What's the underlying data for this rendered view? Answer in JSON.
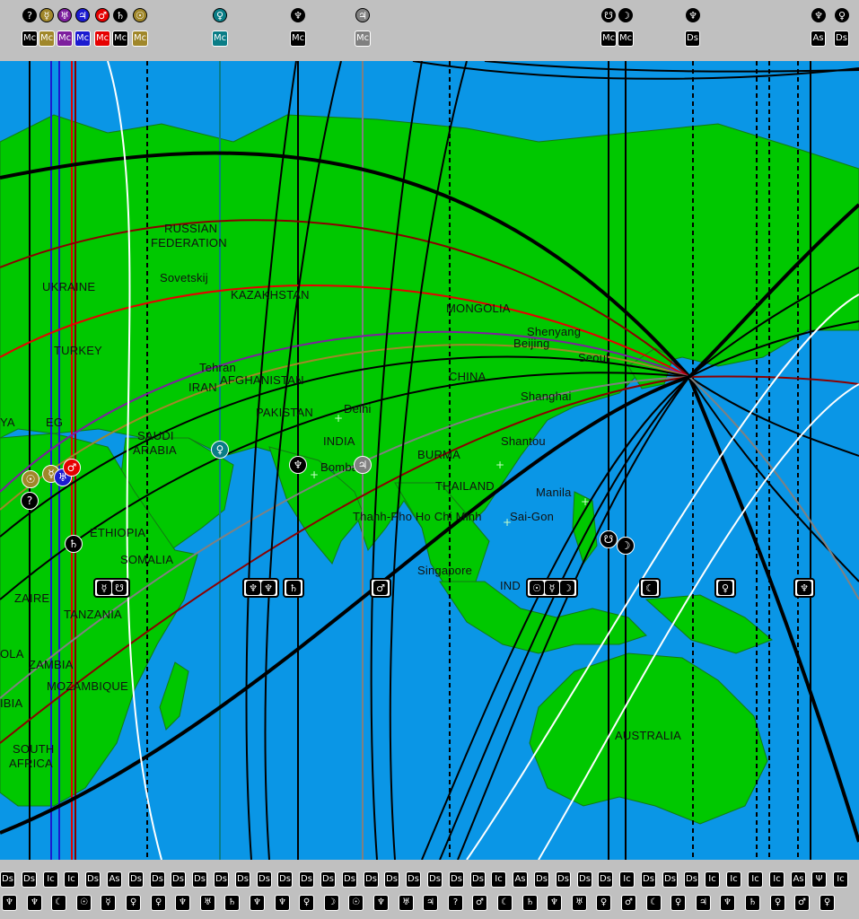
{
  "colors": {
    "ocean": "#0a96e6",
    "land": "#00c800",
    "border": "#137a13",
    "panel": "#c0c0c0"
  },
  "top_markers": [
    {
      "planet": "?",
      "angle": "Mc",
      "bg": "#000000"
    },
    {
      "planet": "☿",
      "angle": "Mc",
      "bg": "#a0872a"
    },
    {
      "planet": "♅",
      "angle": "Mc",
      "bg": "#7d1f9e"
    },
    {
      "planet": "♃",
      "angle": "Mc",
      "bg": "#1a1ad0"
    },
    {
      "planet": "♂",
      "angle": "Mc",
      "bg": "#e60000"
    },
    {
      "planet": "♄",
      "angle": "Mc",
      "bg": "#000000"
    },
    {
      "planet": "☉",
      "angle": "Mc",
      "bg": "#a0872a"
    },
    {
      "planet": "♀",
      "angle": "Mc",
      "bg": "#0a7d86"
    },
    {
      "planet": "♆",
      "angle": "Mc",
      "bg": "#000000"
    },
    {
      "planet": "♃",
      "angle": "Mc",
      "bg": "#808080"
    },
    {
      "planet": "☋",
      "angle": "Mc",
      "bg": "#000000"
    },
    {
      "planet": "☽",
      "angle": "Mc",
      "bg": "#000000"
    },
    {
      "planet": "♆",
      "angle": "Ds",
      "bg": "#000000"
    },
    {
      "planet": "♆",
      "angle": "As",
      "bg": "#000000"
    },
    {
      "planet": "♀",
      "angle": "Ds",
      "bg": "#000000"
    }
  ],
  "bottom_top_row": [
    "Ds",
    "Ds",
    "Ic",
    "Ic",
    "Ds",
    "As",
    "Ds",
    "Ds",
    "Ds",
    "Ds",
    "Ds",
    "Ds",
    "Ds",
    "Ds",
    "Ds",
    "Ds",
    "Ds",
    "Ds",
    "Ds",
    "Ds",
    "Ds",
    "Ds",
    "Ds",
    "Ic",
    "As",
    "Ds",
    "Ds",
    "Ds",
    "Ds",
    "Ic",
    "Ds",
    "Ds",
    "Ds",
    "Ic",
    "Ic",
    "Ic",
    "Ic",
    "As",
    "Ψ",
    "Ic"
  ],
  "bottom_bottom_row": [
    "♆",
    "♆",
    "☾",
    "☉",
    "☿",
    "♀",
    "♀",
    "♆",
    "♅",
    "♄",
    "♆",
    "♆",
    "♀",
    "☽",
    "☉",
    "♆",
    "♅",
    "♃",
    "?",
    "♂",
    "☾",
    "♄",
    "♆",
    "♅",
    "♀",
    "♂",
    "☾",
    "♀",
    "♃",
    "♆",
    "♄",
    "♀",
    "♂",
    "♀"
  ],
  "map_labels": [
    {
      "name": "russian-federation-label",
      "text": "RUSSIAN"
    },
    {
      "name": "federation-label",
      "text": "FEDERATION"
    },
    {
      "name": "sovetskij-label",
      "text": "Sovetskij"
    },
    {
      "name": "ukraine-label",
      "text": "UKRAINE"
    },
    {
      "name": "kazakhstan-label",
      "text": "KAZAKHSTAN"
    },
    {
      "name": "mongolia-label",
      "text": "MONGOLIA"
    },
    {
      "name": "turkey-label",
      "text": "TURKEY"
    },
    {
      "name": "tehran-label",
      "text": "Tehran"
    },
    {
      "name": "afghanistan-label",
      "text": "AFGHANISTAN"
    },
    {
      "name": "iran-label",
      "text": "IRAN"
    },
    {
      "name": "china-label",
      "text": "CHINA"
    },
    {
      "name": "shenyang-label",
      "text": "Shenyang"
    },
    {
      "name": "beijing-label",
      "text": "Beijing"
    },
    {
      "name": "seoul-label",
      "text": "Seoul"
    },
    {
      "name": "shanghai-label",
      "text": "Shanghai"
    },
    {
      "name": "pakistan-label",
      "text": "PAKISTAN"
    },
    {
      "name": "delhi-label",
      "text": "Delhi"
    },
    {
      "name": "india-label",
      "text": "INDIA"
    },
    {
      "name": "bombay-label",
      "text": "Bombay"
    },
    {
      "name": "burma-label",
      "text": "BURMA"
    },
    {
      "name": "shantou-label",
      "text": "Shantou"
    },
    {
      "name": "thailand-label",
      "text": "THAILAND"
    },
    {
      "name": "manila-label",
      "text": "Manila"
    },
    {
      "name": "saigon-label",
      "text": "Sai-Gon"
    },
    {
      "name": "hochiminh-label",
      "text": "Thanh-Pho Ho Chi Minh"
    },
    {
      "name": "saudi-label",
      "text": "SAUDI"
    },
    {
      "name": "arabia-label",
      "text": "ARABIA"
    },
    {
      "name": "egypt-label",
      "text": "EG"
    },
    {
      "name": "ya-label",
      "text": "YA"
    },
    {
      "name": "ethiopia-label",
      "text": "ETHIOPIA"
    },
    {
      "name": "somalia-label",
      "text": "SOMALIA"
    },
    {
      "name": "singapore-label",
      "text": "Singapore"
    },
    {
      "name": "indonesia-label",
      "text": "IND"
    },
    {
      "name": "zaire-label",
      "text": "ZAIRE"
    },
    {
      "name": "tanzania-label",
      "text": "TANZANIA"
    },
    {
      "name": "zambia-label",
      "text": "ZAMBIA"
    },
    {
      "name": "ola-label",
      "text": "OLA"
    },
    {
      "name": "mozambique-label",
      "text": "MOZAMBIQUE"
    },
    {
      "name": "ibia-label",
      "text": "IBIA"
    },
    {
      "name": "south-label",
      "text": "SOUTH"
    },
    {
      "name": "africa-label",
      "text": "AFRICA"
    },
    {
      "name": "australia-label",
      "text": "AUSTRALIA"
    }
  ],
  "map_symbols": [
    {
      "name": "sun-symbol-map",
      "glyph": "☉"
    },
    {
      "name": "mercury-symbol-map",
      "glyph": "☿"
    },
    {
      "name": "uranus-symbol-map",
      "glyph": "♅"
    },
    {
      "name": "mars-symbol-map",
      "glyph": "♂"
    },
    {
      "name": "unknown-symbol-map",
      "glyph": "?"
    },
    {
      "name": "saturn-symbol-map",
      "glyph": "♄"
    },
    {
      "name": "venus-symbol-map",
      "glyph": "♀"
    },
    {
      "name": "neptune-symbol-map",
      "glyph": "♆"
    },
    {
      "name": "jupiter-symbol-map",
      "glyph": "♃"
    },
    {
      "name": "node-symbol-map",
      "glyph": "☋"
    },
    {
      "name": "moon-symbol-map",
      "glyph": "☽"
    }
  ],
  "axis_boxes": [
    {
      "name": "axis-box-1",
      "glyphs": [
        "☿",
        "☋"
      ]
    },
    {
      "name": "axis-box-2",
      "glyphs": [
        "♆",
        "♆"
      ]
    },
    {
      "name": "axis-box-3",
      "glyphs": [
        "♄"
      ]
    },
    {
      "name": "axis-box-4",
      "glyphs": [
        "♂"
      ]
    },
    {
      "name": "axis-box-5",
      "glyphs": [
        "☉",
        "☿",
        "☽"
      ]
    },
    {
      "name": "axis-box-6",
      "glyphs": [
        "☾"
      ]
    },
    {
      "name": "axis-box-7",
      "glyphs": [
        "♀"
      ]
    },
    {
      "name": "axis-box-8",
      "glyphs": [
        "♆"
      ]
    }
  ]
}
